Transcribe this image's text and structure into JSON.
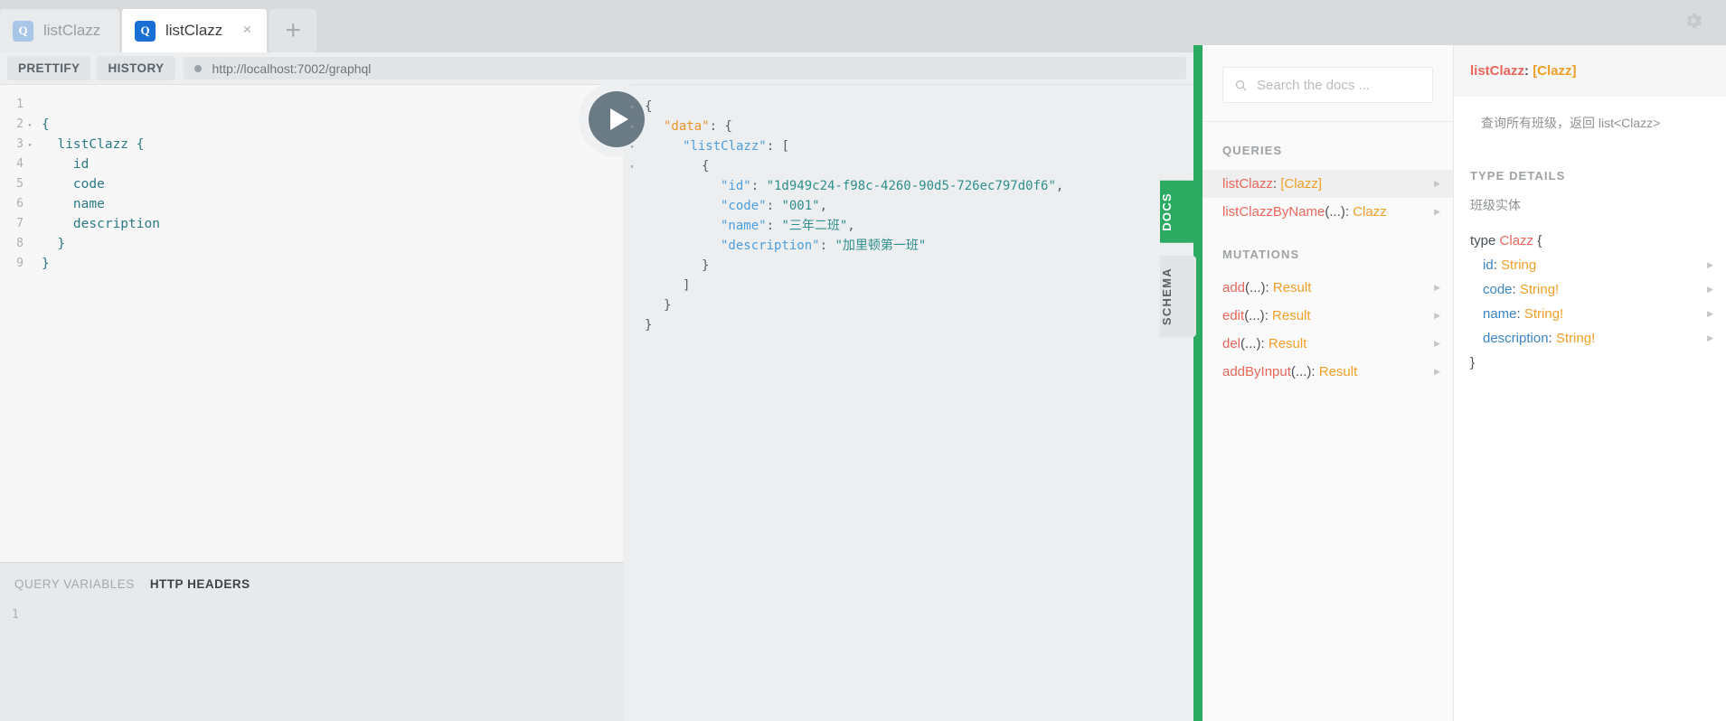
{
  "tabs": [
    {
      "label": "listClazz",
      "icon": "graphql-q-icon",
      "active": false,
      "closable": false
    },
    {
      "label": "listClazz",
      "icon": "graphql-q-icon",
      "active": true,
      "closable": true
    }
  ],
  "tab_add_label": "+",
  "settings_icon": "gear-icon",
  "toolbar": {
    "prettify_label": "PRETTIFY",
    "history_label": "HISTORY",
    "url": "http://localhost:7002/graphql"
  },
  "query_editor": {
    "lines": [
      {
        "num": "1",
        "fold": "",
        "text": ""
      },
      {
        "num": "2",
        "fold": "▾",
        "text": "{"
      },
      {
        "num": "3",
        "fold": "▾",
        "text": "  listClazz {"
      },
      {
        "num": "4",
        "fold": "",
        "text": "    id"
      },
      {
        "num": "5",
        "fold": "",
        "text": "    code"
      },
      {
        "num": "6",
        "fold": "",
        "text": "    name"
      },
      {
        "num": "7",
        "fold": "",
        "text": "    description"
      },
      {
        "num": "8",
        "fold": "",
        "text": "  }"
      },
      {
        "num": "9",
        "fold": "",
        "text": "}"
      }
    ]
  },
  "variables_pane": {
    "query_variables_label": "QUERY VARIABLES",
    "http_headers_label": "HTTP HEADERS",
    "active_tab": "HTTP HEADERS",
    "line_number": "1"
  },
  "run_button": {
    "name": "execute-query-button",
    "icon": "play-icon"
  },
  "result": {
    "lines": [
      {
        "fold": "▾",
        "indent": 0,
        "segments": [
          {
            "t": "{",
            "c": "jpunc"
          }
        ]
      },
      {
        "fold": "▾",
        "indent": 1,
        "segments": [
          {
            "t": "\"data\"",
            "c": "jkey-root"
          },
          {
            "t": ": {",
            "c": "jpunc"
          }
        ]
      },
      {
        "fold": "▾",
        "indent": 2,
        "segments": [
          {
            "t": "\"listClazz\"",
            "c": "jkey"
          },
          {
            "t": ": [",
            "c": "jpunc"
          }
        ]
      },
      {
        "fold": "▾",
        "indent": 3,
        "segments": [
          {
            "t": "{",
            "c": "jpunc"
          }
        ]
      },
      {
        "fold": "",
        "indent": 4,
        "segments": [
          {
            "t": "\"id\"",
            "c": "jkey"
          },
          {
            "t": ": ",
            "c": "jpunc"
          },
          {
            "t": "\"1d949c24-f98c-4260-90d5-726ec797d0f6\"",
            "c": "jstr"
          },
          {
            "t": ",",
            "c": "jpunc"
          }
        ]
      },
      {
        "fold": "",
        "indent": 4,
        "segments": [
          {
            "t": "\"code\"",
            "c": "jkey"
          },
          {
            "t": ": ",
            "c": "jpunc"
          },
          {
            "t": "\"001\"",
            "c": "jstr"
          },
          {
            "t": ",",
            "c": "jpunc"
          }
        ]
      },
      {
        "fold": "",
        "indent": 4,
        "segments": [
          {
            "t": "\"name\"",
            "c": "jkey"
          },
          {
            "t": ": ",
            "c": "jpunc"
          },
          {
            "t": "\"三年二班\"",
            "c": "jstr"
          },
          {
            "t": ",",
            "c": "jpunc"
          }
        ]
      },
      {
        "fold": "",
        "indent": 4,
        "segments": [
          {
            "t": "\"description\"",
            "c": "jkey"
          },
          {
            "t": ": ",
            "c": "jpunc"
          },
          {
            "t": "\"加里顿第一班\"",
            "c": "jstr"
          }
        ]
      },
      {
        "fold": "",
        "indent": 3,
        "segments": [
          {
            "t": "}",
            "c": "jpunc"
          }
        ]
      },
      {
        "fold": "",
        "indent": 2,
        "segments": [
          {
            "t": "]",
            "c": "jpunc"
          }
        ]
      },
      {
        "fold": "",
        "indent": 1,
        "segments": [
          {
            "t": "}",
            "c": "jpunc"
          }
        ]
      },
      {
        "fold": "",
        "indent": 0,
        "segments": [
          {
            "t": "}",
            "c": "jpunc"
          }
        ]
      }
    ]
  },
  "side_tabs": [
    {
      "label": "DOCS",
      "active": true
    },
    {
      "label": "SCHEMA",
      "active": false
    }
  ],
  "docs": {
    "search_placeholder": "Search the docs ...",
    "search_icon": "search-icon",
    "sections": [
      {
        "heading": "QUERIES",
        "rows": [
          {
            "name": "listClazz",
            "args": "",
            "type": "[Clazz]",
            "selected": true
          },
          {
            "name": "listClazzByName",
            "args": "(...)",
            "type": "Clazz",
            "selected": false
          }
        ]
      },
      {
        "heading": "MUTATIONS",
        "rows": [
          {
            "name": "add",
            "args": "(...)",
            "type": "Result",
            "selected": false
          },
          {
            "name": "edit",
            "args": "(...)",
            "type": "Result",
            "selected": false
          },
          {
            "name": "del",
            "args": "(...)",
            "type": "Result",
            "selected": false
          },
          {
            "name": "addByInput",
            "args": "(...)",
            "type": "Result",
            "selected": false
          }
        ]
      }
    ]
  },
  "type_details": {
    "header_name": "listClazz",
    "header_type": "[Clazz]",
    "description": "查询所有班级，返回 list<Clazz>",
    "section_heading": "TYPE DETAILS",
    "entity_description": "班级实体",
    "type_keyword": "type",
    "type_name": "Clazz",
    "open_brace": "{",
    "close_brace": "}",
    "fields": [
      {
        "name": "id",
        "type": "String"
      },
      {
        "name": "code",
        "type": "String!"
      },
      {
        "name": "name",
        "type": "String!"
      },
      {
        "name": "description",
        "type": "String!"
      }
    ]
  },
  "colors": {
    "accent_green": "#2bab62",
    "tab_active_blue": "#1a6fd4",
    "json_key": "#4c9fdc",
    "json_root_key": "#e8922c",
    "json_string": "#2f8f8c",
    "docs_field": "#e8675b",
    "docs_type": "#f0a028",
    "type_field": "#3a84c4"
  }
}
